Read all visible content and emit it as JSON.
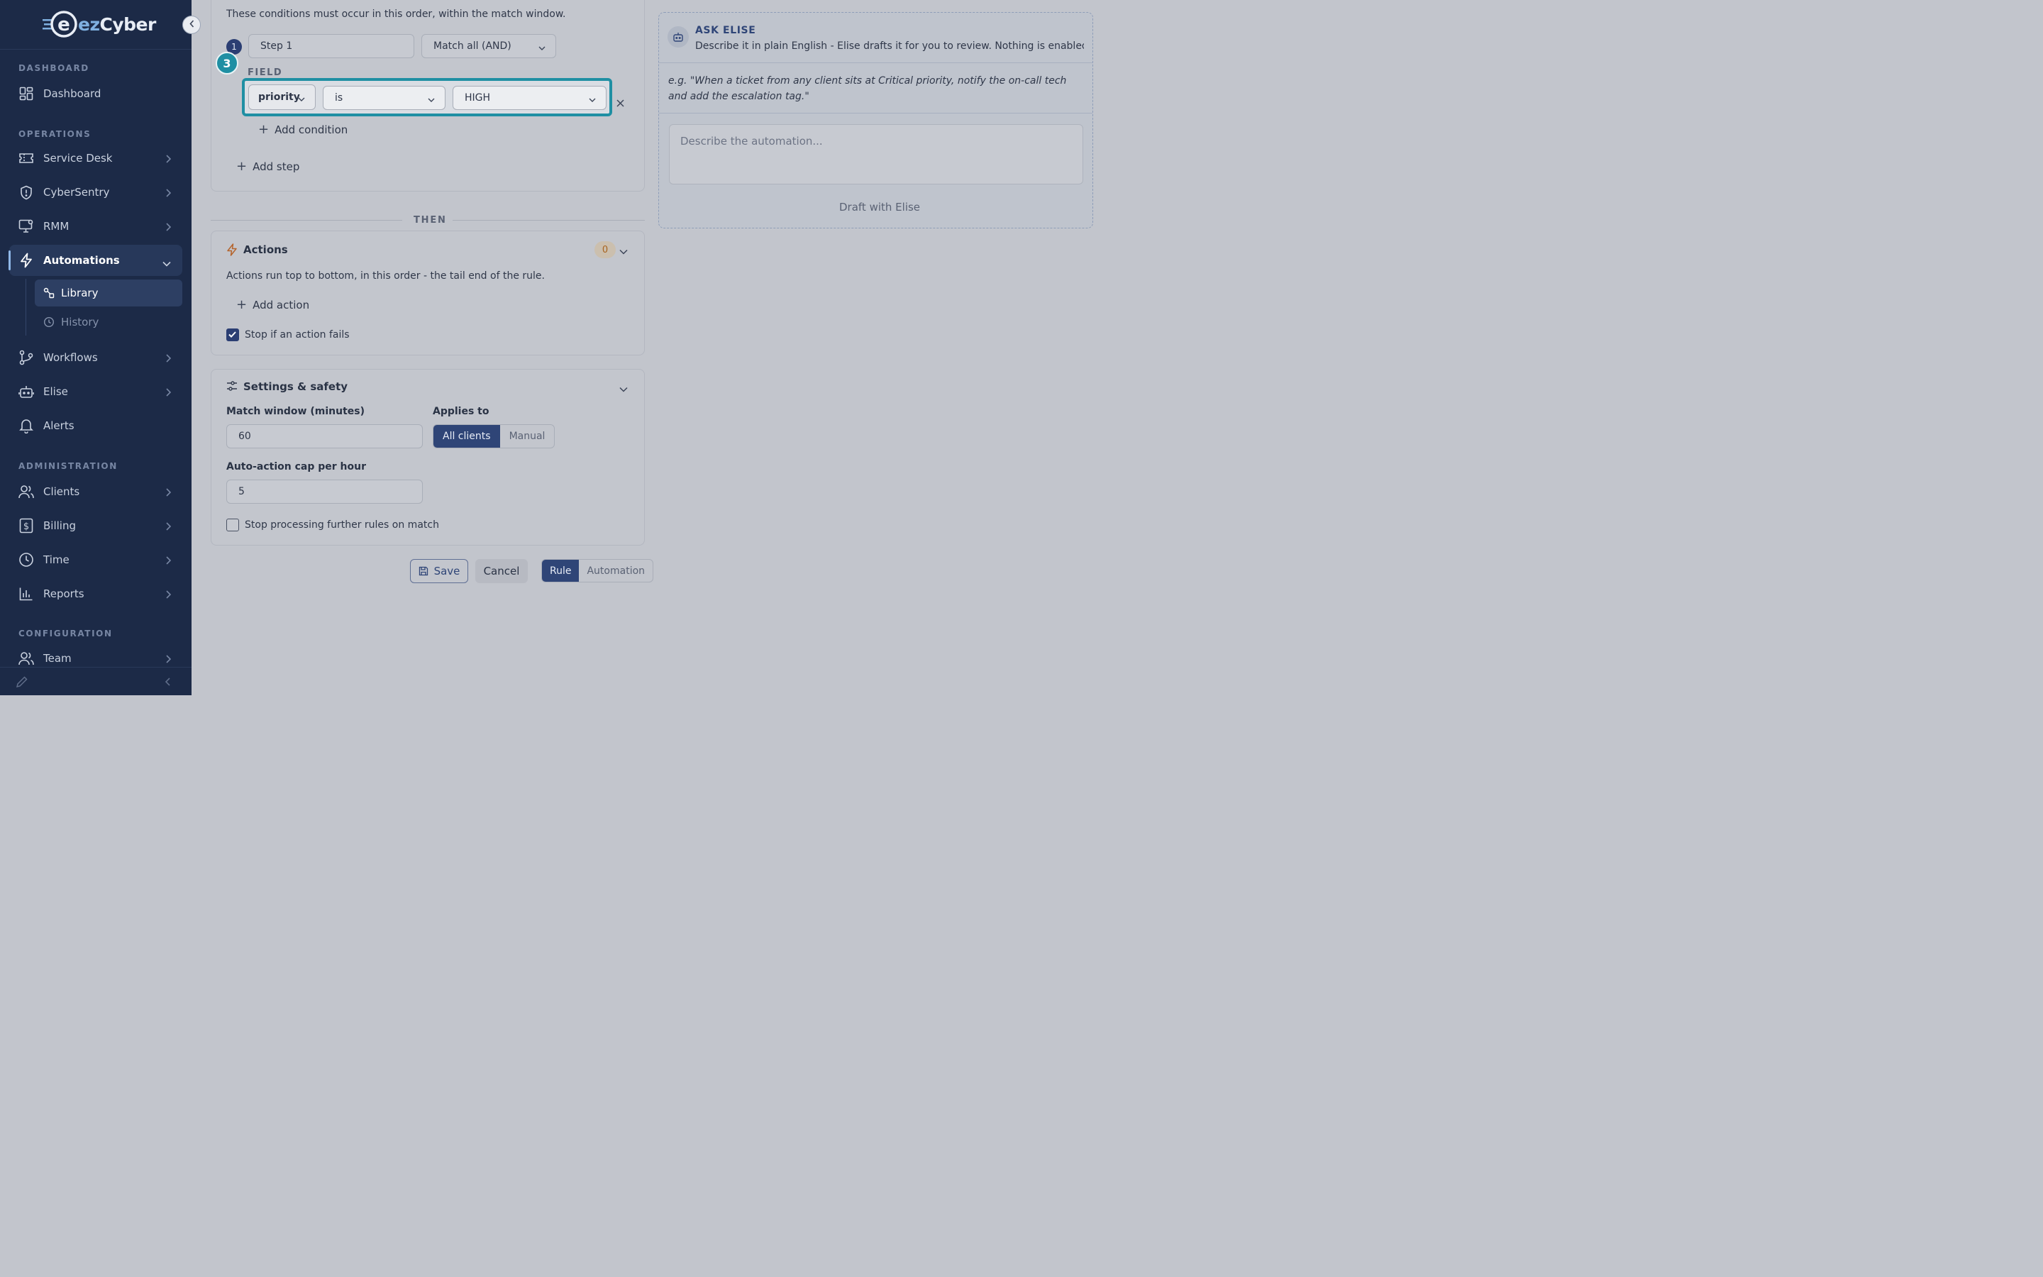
{
  "brand": {
    "ez": "ez",
    "cyber": "Cyber"
  },
  "sidebar": {
    "sections": {
      "dashboard": "DASHBOARD",
      "operations": "OPERATIONS",
      "administration": "ADMINISTRATION",
      "configuration": "CONFIGURATION"
    },
    "items": {
      "dashboard": "Dashboard",
      "service_desk": "Service Desk",
      "cybersentry": "CyberSentry",
      "rmm": "RMM",
      "automations": "Automations",
      "library": "Library",
      "history": "History",
      "workflows": "Workflows",
      "elise": "Elise",
      "alerts": "Alerts",
      "clients": "Clients",
      "billing": "Billing",
      "time": "Time",
      "reports": "Reports",
      "team": "Team"
    }
  },
  "conditions": {
    "description": "These conditions must occur in this order, within the match window.",
    "step_number": "1",
    "step_name": "Step 1",
    "match_mode": "Match all (AND)",
    "callout_number": "3",
    "field_label": "FIELD",
    "condition": {
      "field": "priority",
      "operator": "is",
      "value": "HIGH"
    },
    "add_condition": "Add condition",
    "add_step": "Add step"
  },
  "then_label": "THEN",
  "actions": {
    "title": "Actions",
    "count": "0",
    "description": "Actions run top to bottom, in this order - the tail end of the rule.",
    "add_action": "Add action",
    "stop_on_fail": "Stop if an action fails",
    "stop_on_fail_checked": true
  },
  "settings": {
    "title": "Settings & safety",
    "match_window_label": "Match window (minutes)",
    "match_window_value": "60",
    "applies_to_label": "Applies to",
    "applies_to_options": [
      "All clients",
      "Manual"
    ],
    "cap_label": "Auto-action cap per hour",
    "cap_value": "5",
    "stop_processing": "Stop processing further rules on match"
  },
  "footer": {
    "save": "Save",
    "cancel": "Cancel",
    "mode_options": [
      "Rule",
      "Automation"
    ]
  },
  "elise_panel": {
    "title": "ASK ELISE",
    "subtitle": "Describe it in plain English - Elise drafts it for you to review. Nothing is enabled or ar...",
    "example": "e.g. \"When a ticket from any client sits at Critical priority, notify the on-call tech and add the escalation tag.\"",
    "placeholder": "Describe the automation...",
    "draft_button": "Draft with Elise"
  }
}
